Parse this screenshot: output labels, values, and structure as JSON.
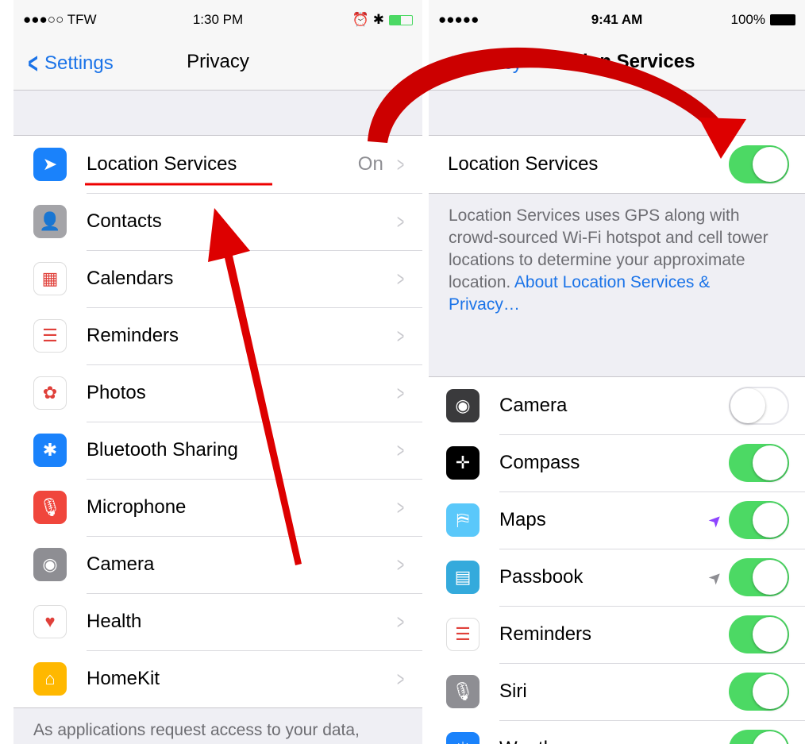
{
  "left": {
    "status": {
      "carrier": "●●●○○ TFW",
      "time": "1:30 PM",
      "right_icons": "⏰ ✱"
    },
    "nav": {
      "back_label": "Settings",
      "title": "Privacy"
    },
    "items": [
      {
        "label": "Location Services",
        "detail": "On",
        "icon": "location-arrow-icon",
        "color": "#1a82fb",
        "glyph": "➤"
      },
      {
        "label": "Contacts",
        "detail": "",
        "icon": "contacts-icon",
        "color": "#a4a4a8",
        "glyph": "👤"
      },
      {
        "label": "Calendars",
        "detail": "",
        "icon": "calendar-icon",
        "color": "#ffffff",
        "glyph": "▦"
      },
      {
        "label": "Reminders",
        "detail": "",
        "icon": "reminders-icon",
        "color": "#ffffff",
        "glyph": "☰"
      },
      {
        "label": "Photos",
        "detail": "",
        "icon": "photos-icon",
        "color": "#ffffff",
        "glyph": "✿"
      },
      {
        "label": "Bluetooth Sharing",
        "detail": "",
        "icon": "bluetooth-icon",
        "color": "#1a82fb",
        "glyph": "✱"
      },
      {
        "label": "Microphone",
        "detail": "",
        "icon": "microphone-icon",
        "color": "#f0463c",
        "glyph": "🎙"
      },
      {
        "label": "Camera",
        "detail": "",
        "icon": "camera-icon",
        "color": "#8e8e93",
        "glyph": "◉"
      },
      {
        "label": "Health",
        "detail": "",
        "icon": "health-icon",
        "color": "#ffffff",
        "glyph": "♥"
      },
      {
        "label": "HomeKit",
        "detail": "",
        "icon": "homekit-icon",
        "color": "#ffb800",
        "glyph": "⌂"
      }
    ],
    "footer": "As applications request access to your data,"
  },
  "right": {
    "status": {
      "carrier": "●●●●● ",
      "time": "9:41 AM",
      "battery": "100%"
    },
    "nav": {
      "back_label": "Privacy",
      "title": "Location Services"
    },
    "master": {
      "label": "Location Services",
      "on": true
    },
    "description": "Location Services uses GPS along with crowd-sourced Wi-Fi hotspot and cell tower locations to determine your approximate location.",
    "about_link": "About Location Services & Privacy…",
    "apps": [
      {
        "label": "Camera",
        "on": false,
        "icon": "camera-icon",
        "color": "#3a3a3c",
        "glyph": "◉",
        "arrow": ""
      },
      {
        "label": "Compass",
        "on": true,
        "icon": "compass-icon",
        "color": "#000000",
        "glyph": "✛",
        "arrow": ""
      },
      {
        "label": "Maps",
        "on": true,
        "icon": "maps-icon",
        "color": "#5ac8fa",
        "glyph": "⛿",
        "arrow": "purple"
      },
      {
        "label": "Passbook",
        "on": true,
        "icon": "passbook-icon",
        "color": "#34aadc",
        "glyph": "▤",
        "arrow": "gray"
      },
      {
        "label": "Reminders",
        "on": true,
        "icon": "reminders-icon",
        "color": "#ffffff",
        "glyph": "☰",
        "arrow": ""
      },
      {
        "label": "Siri",
        "on": true,
        "icon": "siri-icon",
        "color": "#8e8e93",
        "glyph": "🎙",
        "arrow": ""
      },
      {
        "label": "Weather",
        "on": true,
        "icon": "weather-icon",
        "color": "#1a82fb",
        "glyph": "☀",
        "arrow": ""
      }
    ]
  },
  "colors": {
    "accent": "#1a73e8",
    "toggle_on": "#4cd964",
    "annotation_arrow": "#dd0000"
  }
}
